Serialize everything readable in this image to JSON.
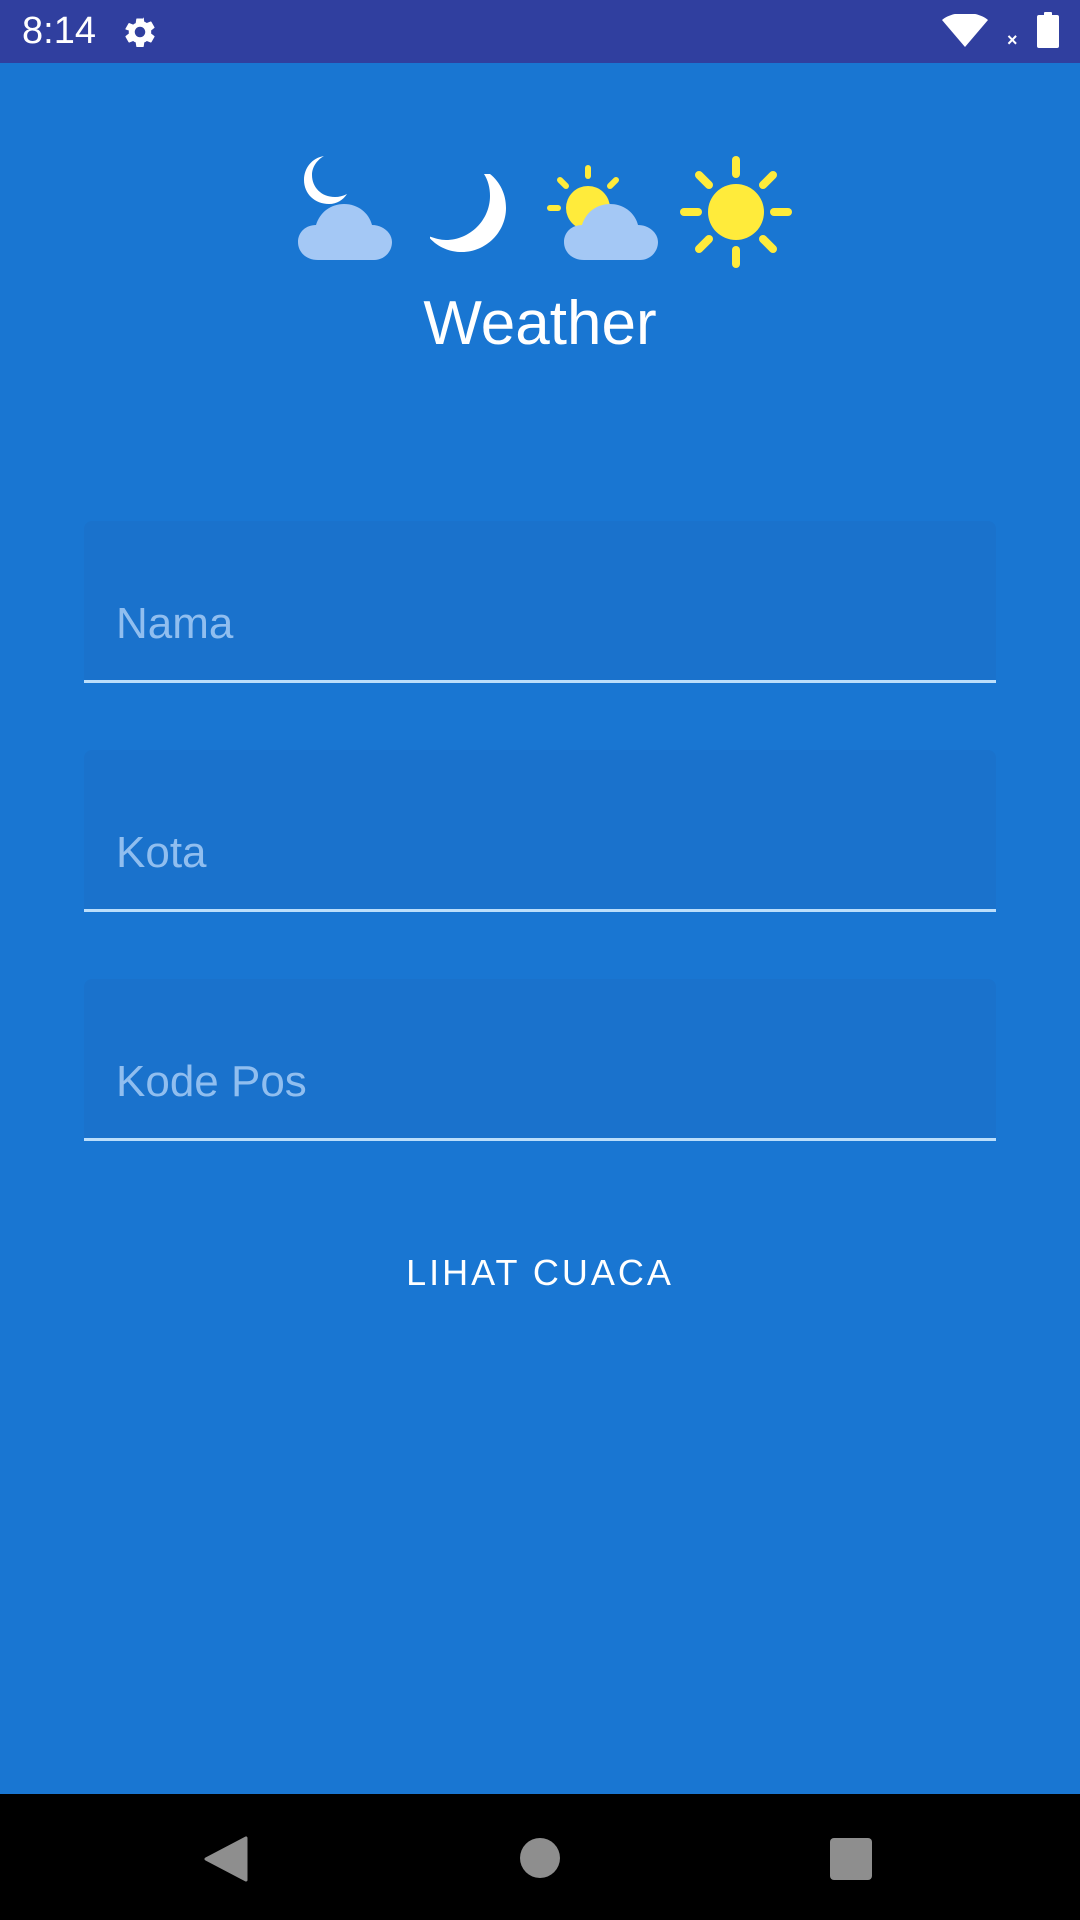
{
  "status_bar": {
    "time": "8:14",
    "icons": [
      "gear-icon",
      "wifi-icon",
      "no-data-icon",
      "battery-icon"
    ],
    "no_data_mark": "×"
  },
  "header": {
    "icons": [
      "moon-cloud-icon",
      "moon-icon",
      "sun-cloud-icon",
      "sun-icon"
    ],
    "title": "Weather"
  },
  "form": {
    "name_placeholder": "Nama",
    "city_placeholder": "Kota",
    "zip_placeholder": "Kode Pos",
    "name_value": "",
    "city_value": "",
    "zip_value": ""
  },
  "action": {
    "label": "LIHAT CUACA"
  },
  "nav": {
    "icons": [
      "back-icon",
      "home-icon",
      "recents-icon"
    ]
  },
  "colors": {
    "background": "#1976D2",
    "status_bar": "#303F9F",
    "field_background": "#1A72CC",
    "field_underline": "#BBDEFB",
    "placeholder": "#90BEEF",
    "sun": "#FFEB3B",
    "cloud": "#A4C8F5",
    "moon": "#FFFFFF"
  }
}
